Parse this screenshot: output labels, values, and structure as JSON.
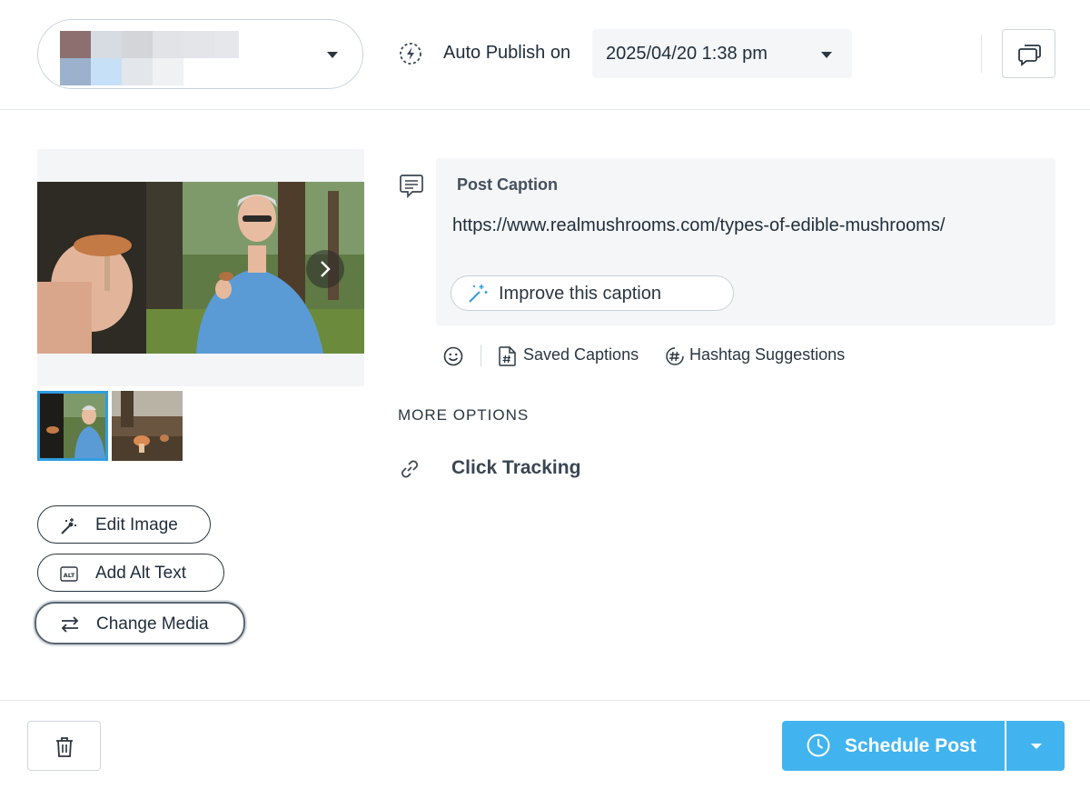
{
  "header": {
    "account": {
      "name": "",
      "icon": "chevron-down-icon"
    },
    "auto_publish": {
      "icon": "auto-publish-icon",
      "label": "Auto Publish on"
    },
    "publish_date": {
      "value": "2025/04/20 1:38 pm",
      "icon": "chevron-down-icon"
    },
    "comments_button": {
      "icon": "comments-icon"
    }
  },
  "media": {
    "next_icon": "chevron-right-icon",
    "selected_thumbnail_index": 0,
    "selected_color": "#2f9ee0",
    "buttons": {
      "edit_image": {
        "label": "Edit Image",
        "icon": "magic-wand-icon"
      },
      "add_alt_text": {
        "label": "Add Alt Text",
        "icon": "alt-text-icon"
      },
      "change_media": {
        "label": "Change Media",
        "icon": "swap-arrows-icon"
      }
    }
  },
  "caption": {
    "icon": "caption-icon",
    "title": "Post Caption",
    "text": "https://www.realmushrooms.com/types-of-edible-mushrooms/",
    "improve": {
      "label": "Improve this caption",
      "icon": "ai-wand-icon"
    },
    "tools": {
      "emoji": {
        "icon": "emoji-icon"
      },
      "saved": {
        "label": "Saved Captions",
        "icon": "saved-captions-icon"
      },
      "hashtag": {
        "label": "Hashtag Suggestions",
        "icon": "hashtag-icon"
      }
    }
  },
  "more_options": {
    "heading": "MORE OPTIONS",
    "click_tracking": {
      "label": "Click Tracking",
      "icon": "link-icon"
    }
  },
  "footer": {
    "delete": {
      "icon": "trash-icon"
    },
    "schedule": {
      "label": "Schedule Post",
      "icon": "clock-icon",
      "color": "#41b4f0"
    },
    "schedule_menu": {
      "icon": "chevron-down-icon"
    }
  }
}
